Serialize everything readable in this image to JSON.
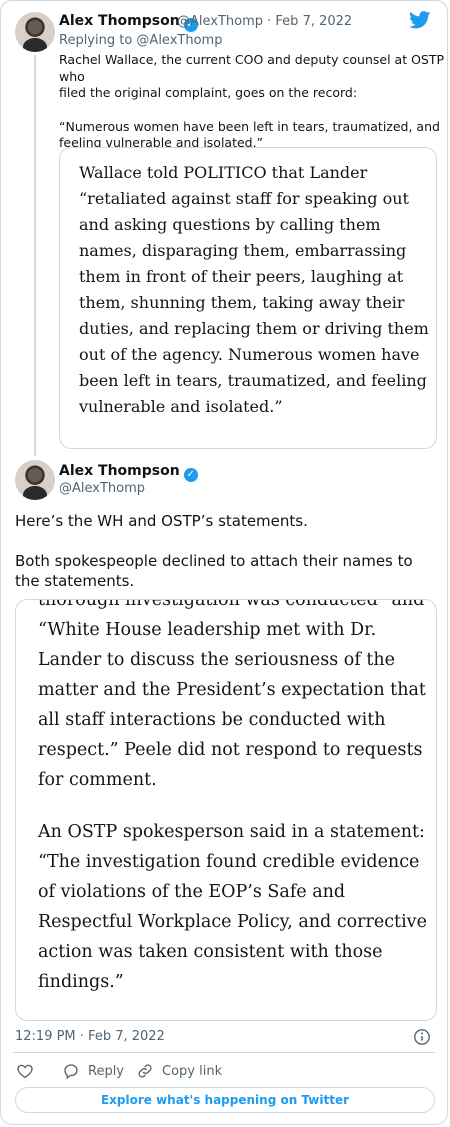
{
  "reply_tweet": {
    "author_name": "Alex Thompson",
    "handle_date": "@AlexThomp · Feb 7, 2022",
    "replying_to": "Replying to @AlexThomp",
    "text_line1": "Rachel Wallace, the current COO and deputy counsel at OSTP who",
    "text_line2": "filed the original complaint, goes on the record:",
    "quote_line1": "“Numerous women have been left in tears, traumatized, and",
    "quote_line2": "feeling vulnerable and isolated.”",
    "image_text": [
      "Wallace told POLITICO that Lander",
      "“retaliated against staff for speaking out",
      "and asking questions by calling them",
      "names, disparaging them, embarrassing",
      "them in front of their peers, laughing at",
      "them, shunning them, taking away their",
      "duties, and replacing them or driving them",
      "out of the agency. Numerous women have",
      "been left in tears, traumatized, and feeling",
      "vulnerable and isolated.”"
    ]
  },
  "main_tweet": {
    "author_name": "Alex Thompson",
    "handle": "@AlexThomp",
    "text_p1": "Here’s the WH and OSTP’s statements.",
    "text_p2_line1": "Both spokespeople declined to attach their names to",
    "text_p2_line2": "the statements.",
    "image_cut_line": "thorough investigation was conducted\" and",
    "image_text": [
      "“White House leadership met with Dr.",
      "Lander to discuss the seriousness of the",
      "matter and the President’s expectation that",
      "all staff interactions be conducted with",
      "respect.” Peele did not respond to requests",
      "for comment.",
      "",
      "An OSTP spokesperson said in a statement:",
      "“The investigation found credible evidence",
      "of violations of the EOP’s Safe and",
      "Respectful Workplace Policy, and corrective",
      "action was taken consistent with those",
      "findings.”"
    ],
    "timestamp": "12:19 PM · Feb 7, 2022"
  },
  "actions": {
    "reply_label": "Reply",
    "copy_link_label": "Copy link",
    "explore_label": "Explore what's happening on Twitter"
  },
  "colors": {
    "accent": "#1d9bf0",
    "muted": "#536471",
    "like": "#536471"
  },
  "icons": [
    "twitter-logo-icon",
    "verified-icon",
    "info-icon",
    "heart-icon",
    "reply-icon",
    "link-icon"
  ]
}
